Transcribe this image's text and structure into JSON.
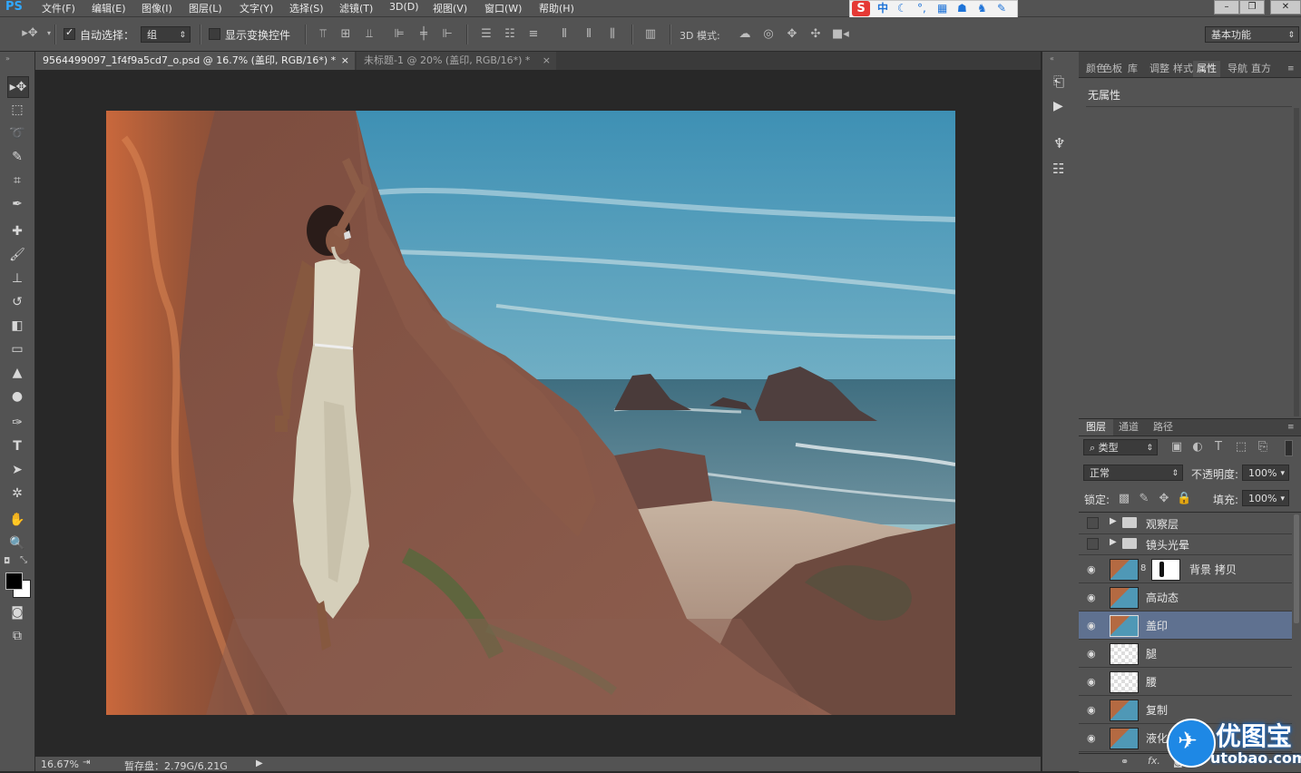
{
  "app": {
    "logo": "PS"
  },
  "menu": [
    "文件(F)",
    "编辑(E)",
    "图像(I)",
    "图层(L)",
    "文字(Y)",
    "选择(S)",
    "滤镜(T)",
    "3D(D)",
    "视图(V)",
    "窗口(W)",
    "帮助(H)"
  ],
  "ime": {
    "logo": "S",
    "mode": "中"
  },
  "options": {
    "auto_select_label": "自动选择：",
    "auto_select_value": "组",
    "show_transform_label": "显示变换控件",
    "mode_3d_label": "3D 模式:",
    "workspace": "基本功能"
  },
  "tabs": [
    {
      "title": "9564499097_1f4f9a5cd7_o.psd @ 16.7% (盖印, RGB/16*) *",
      "close": "×"
    },
    {
      "title": "未标题-1 @ 20% (盖印, RGB/16*) *",
      "close": "×"
    }
  ],
  "status": {
    "zoom": "16.67%",
    "scratch": "暂存盘：2.79G/6.21G"
  },
  "properties_tabs": [
    "颜色",
    "色板",
    "库",
    "调整",
    "样式",
    "属性",
    "导航",
    "直方"
  ],
  "properties": {
    "empty_text": "无属性"
  },
  "layers_tabs": [
    "图层",
    "通道",
    "路径"
  ],
  "layers_panel": {
    "filter": "类型",
    "blend_mode": "正常",
    "opacity_label": "不透明度:",
    "opacity": "100%",
    "lock_label": "锁定:",
    "fill_label": "填充:",
    "fill": "100%"
  },
  "layers": [
    {
      "name": "观察层",
      "type": "group",
      "visible": false
    },
    {
      "name": "镜头光晕",
      "type": "group",
      "visible": false
    },
    {
      "name": "背景 拷贝",
      "type": "masked",
      "visible": true
    },
    {
      "name": "高动态",
      "type": "image",
      "visible": true
    },
    {
      "name": "盖印",
      "type": "image",
      "visible": true,
      "selected": true
    },
    {
      "name": "腿",
      "type": "transparent",
      "visible": true
    },
    {
      "name": "腰",
      "type": "transparent",
      "visible": true
    },
    {
      "name": "复制",
      "type": "image",
      "visible": true
    },
    {
      "name": "液化",
      "type": "image",
      "visible": true
    }
  ],
  "watermark": {
    "cn": "优图宝",
    "url": "utobao.com"
  },
  "colors": {
    "panel": "#535353",
    "canvas_bg": "#282828",
    "selected_layer": "#5f7190",
    "accent": "#31a8ff"
  }
}
